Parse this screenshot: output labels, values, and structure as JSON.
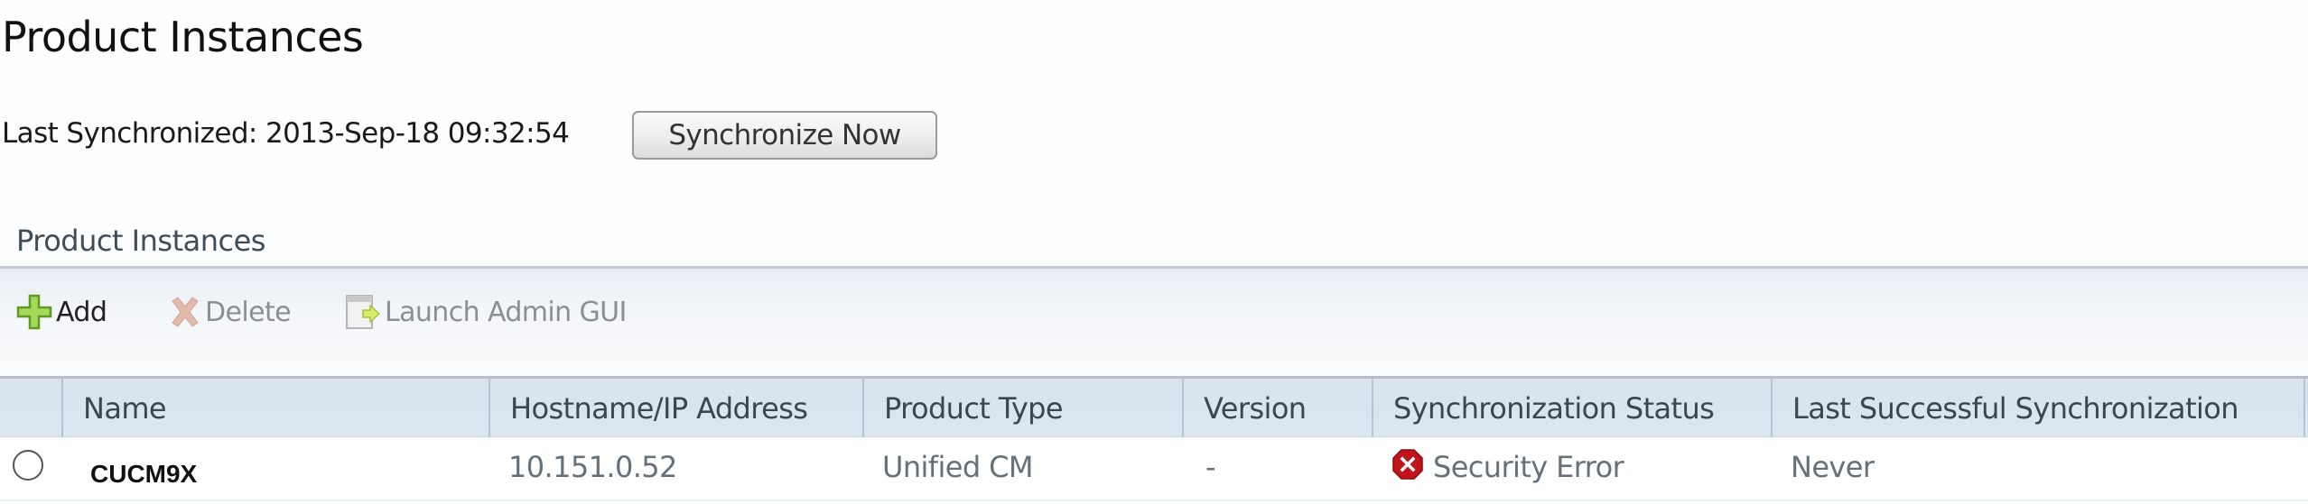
{
  "page": {
    "title": "Product Instances",
    "last_synchronized_label": "Last Synchronized: 2013-Sep-18 09:32:54",
    "synchronize_button": "Synchronize Now"
  },
  "section": {
    "title": "Product Instances",
    "toolbar": {
      "add": {
        "label": "Add",
        "icon": "plus-icon",
        "enabled": true
      },
      "delete": {
        "label": "Delete",
        "icon": "delete-x-icon",
        "enabled": false
      },
      "launch": {
        "label": "Launch Admin GUI",
        "icon": "launch-window-icon",
        "enabled": false
      }
    }
  },
  "table": {
    "columns": [
      "Name",
      "Hostname/IP Address",
      "Product Type",
      "Version",
      "Synchronization Status",
      "Last Successful Synchronization"
    ],
    "rows": [
      {
        "selected": false,
        "name": "CUCM9X",
        "hostname": "10.151.0.52",
        "product_type": "Unified CM",
        "version": "-",
        "sync_status": "Security Error",
        "sync_status_icon": "error-icon",
        "last_success": "Never"
      }
    ]
  },
  "colors": {
    "error": "#c0141a",
    "add_icon": "#8cc63f",
    "header_bg": "#d9e4ef"
  }
}
